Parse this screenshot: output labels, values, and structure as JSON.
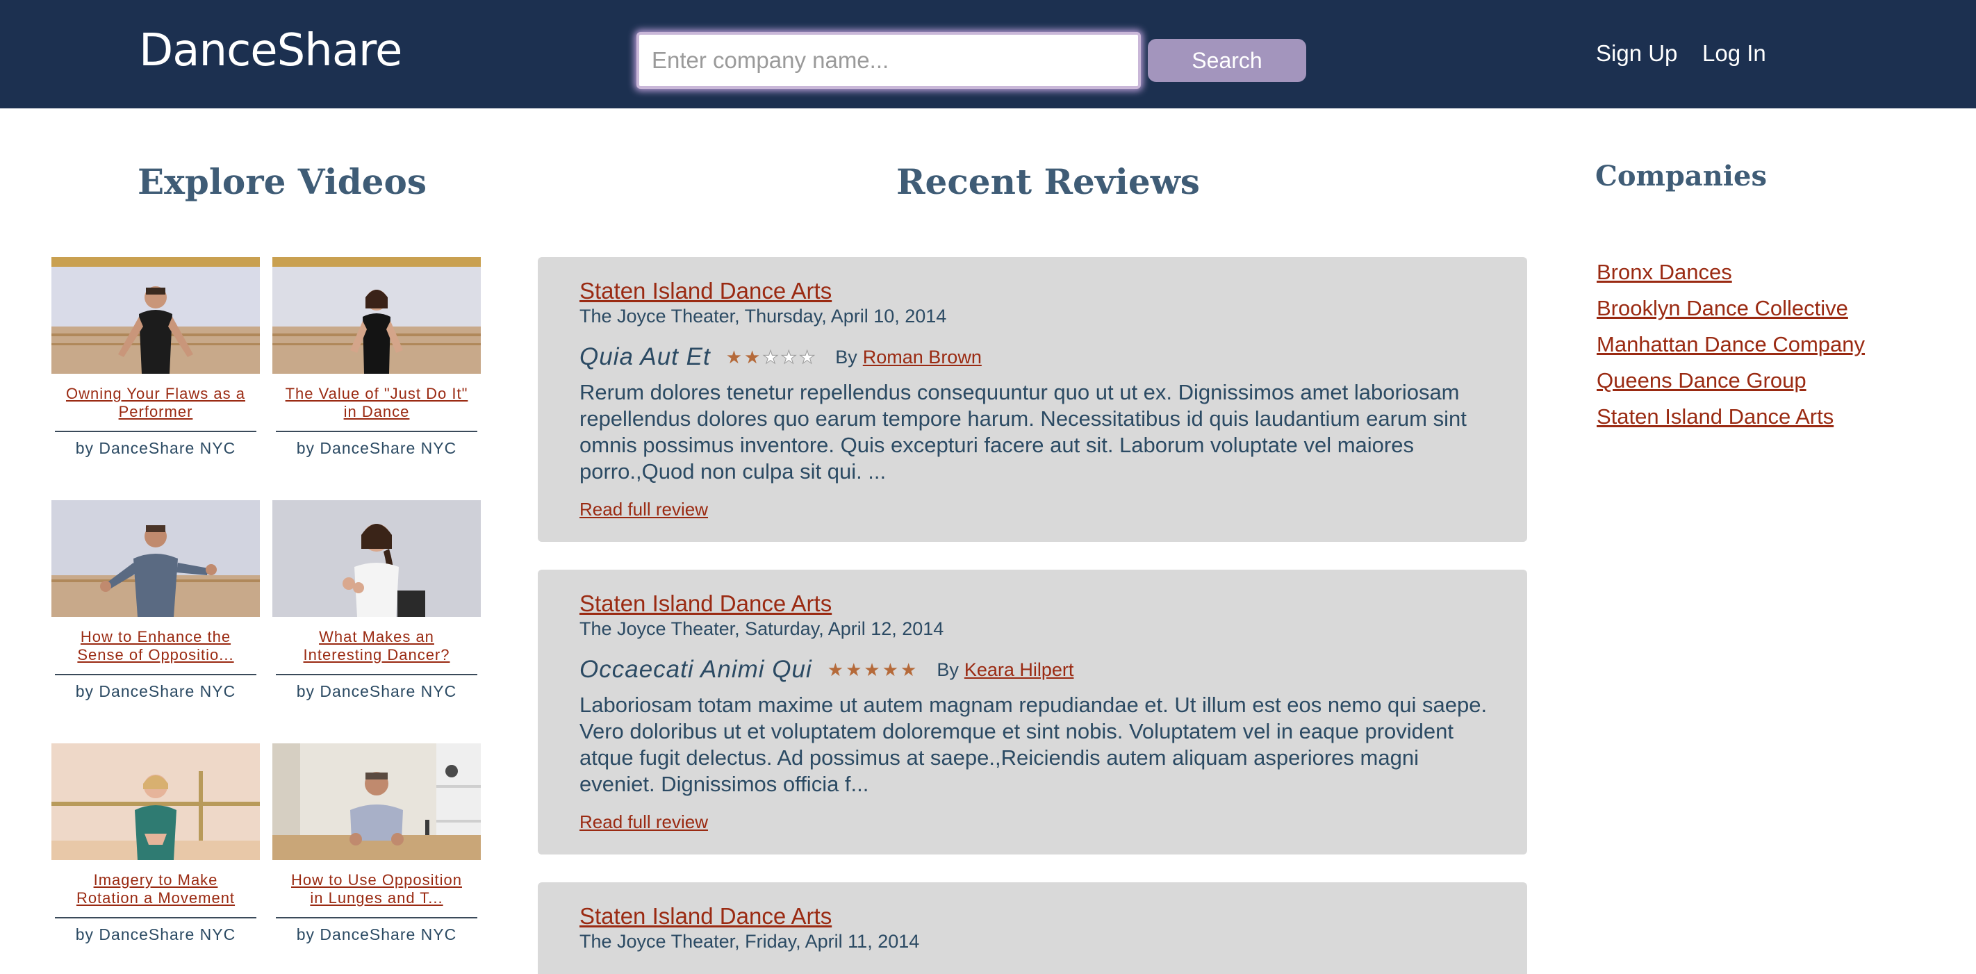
{
  "header": {
    "logo": "DanceShare",
    "search_placeholder": "Enter company name...",
    "search_button": "Search",
    "nav": {
      "signup": "Sign Up",
      "login": "Log In"
    },
    "colors": {
      "background": "#1c3050",
      "search_button": "#a395bd"
    }
  },
  "explore": {
    "title": "Explore Videos",
    "videos": [
      {
        "title_line1": "Owning Your Flaws as a",
        "title_line2": "Performer",
        "author": "by DanceShare NYC"
      },
      {
        "title_line1": "The Value of \"Just Do It\"",
        "title_line2": "in Dance",
        "author": "by DanceShare NYC"
      },
      {
        "title_line1": "How to Enhance the",
        "title_line2": "Sense of Oppositio...",
        "author": "by DanceShare NYC"
      },
      {
        "title_line1": "What Makes an",
        "title_line2": "Interesting Dancer?",
        "author": "by DanceShare NYC"
      },
      {
        "title_line1": "Imagery to Make",
        "title_line2": "Rotation a Movement",
        "author": "by DanceShare NYC"
      },
      {
        "title_line1": "How to Use Opposition",
        "title_line2": "in Lunges and T...",
        "author": "by DanceShare NYC"
      }
    ]
  },
  "reviews": {
    "title": "Recent Reviews",
    "items": [
      {
        "company": "Staten Island Dance Arts",
        "meta": "The Joyce Theater, Thursday, April 10, 2014",
        "title": "Quia Aut Et",
        "rating": 2,
        "by": "By",
        "author": "Roman Brown",
        "body": "Rerum dolores tenetur repellendus consequuntur quo ut ut ex. Dignissimos amet laboriosam repellendus dolores quo earum tempore harum. Necessitatibus id quis laudantium earum sint omnis possimus inventore. Quis excepturi facere aut sit. Laborum voluptate vel maiores porro.,Quod non culpa sit qui. ...",
        "read_more": "Read full review"
      },
      {
        "company": "Staten Island Dance Arts",
        "meta": "The Joyce Theater, Saturday, April 12, 2014",
        "title": "Occaecati Animi Qui",
        "rating": 5,
        "by": "By",
        "author": "Keara Hilpert",
        "body": "Laboriosam totam maxime ut autem magnam repudiandae et. Ut illum est eos nemo qui saepe. Vero doloribus ut et voluptatem doloremque et sint nobis. Voluptatem vel in eaque provident atque fugit delectus. Ad possimus at saepe.,Reiciendis autem aliquam asperiores magni eveniet. Dignissimos officia f...",
        "read_more": "Read full review"
      },
      {
        "company": "Staten Island Dance Arts",
        "meta": "The Joyce Theater, Friday, April 11, 2014"
      }
    ],
    "colors": {
      "card": "#d9d9d9",
      "star": "#b56a3a",
      "link": "#9a2a12"
    }
  },
  "companies": {
    "title": "Companies",
    "items": [
      "Bronx Dances",
      "Brooklyn Dance Collective",
      "Manhattan Dance Company",
      "Queens Dance Group",
      "Staten Island Dance Arts"
    ]
  }
}
